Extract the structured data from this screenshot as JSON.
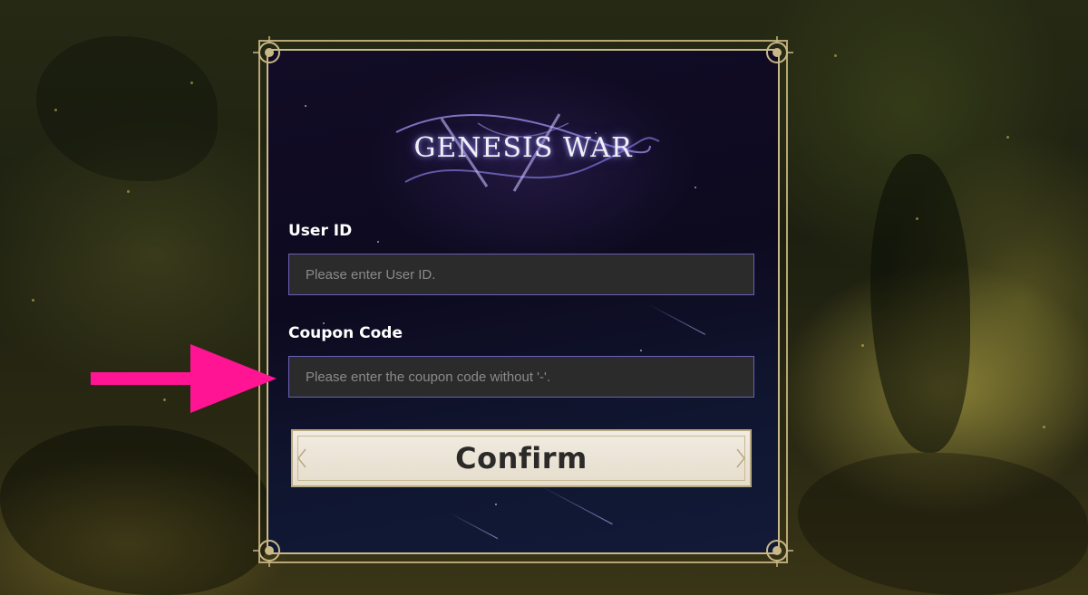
{
  "logo": {
    "text": "GENESIS WAR"
  },
  "form": {
    "user_id": {
      "label": "User ID",
      "value": "",
      "placeholder": "Please enter User ID."
    },
    "coupon_code": {
      "label": "Coupon Code",
      "value": "",
      "placeholder": "Please enter the coupon code without '-'."
    },
    "confirm_label": "Confirm"
  },
  "annotation": {
    "arrow_icon": "arrow-right-icon",
    "color": "#ff1493"
  },
  "colors": {
    "panel_background": "#0d0a1f",
    "frame_gold": "#c9b888",
    "input_background": "#2b2b2b",
    "input_border": "#6a60b8",
    "button_background": "#f1ece2",
    "button_text": "#2c2a28"
  }
}
